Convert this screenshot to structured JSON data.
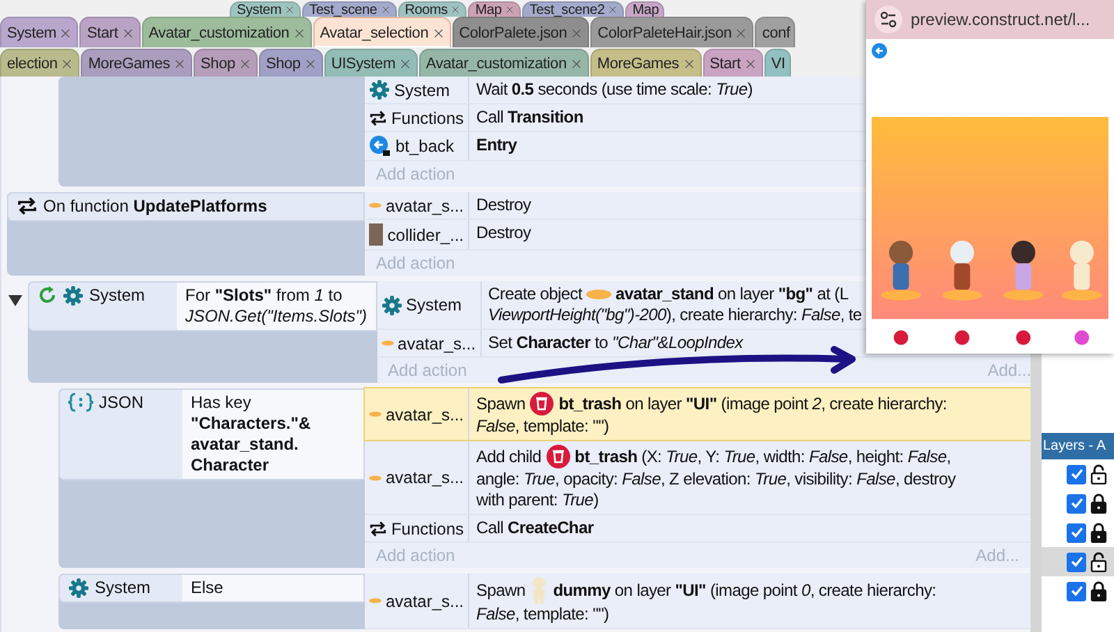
{
  "tab_rows": [
    {
      "tabs": [
        {
          "label": "System",
          "color": "#9ec3be",
          "selected": false
        },
        {
          "label": "Test_scene",
          "color": "#a3aacb",
          "selected": false
        },
        {
          "label": "Rooms",
          "color": "#9fc2c0",
          "selected": false
        },
        {
          "label": "Map",
          "color": "#cba2b3",
          "selected": false
        },
        {
          "label": "Test_scene2",
          "color": "#a3aacb",
          "selected": false
        },
        {
          "label": "Map",
          "color": "#c6a6c6",
          "selected": false
        }
      ]
    },
    {
      "tabs": [
        {
          "label": "System",
          "color": "#b8a6cc",
          "selected": false
        },
        {
          "label": "Start",
          "color": "#b9a2c3",
          "selected": false
        },
        {
          "label": "Avatar_customization",
          "color": "#9cbc9c",
          "selected": false
        },
        {
          "label": "Avatar_selection",
          "color": "#fde3d4",
          "selected": true
        },
        {
          "label": "ColorPalete.json",
          "color": "#8e8e8e",
          "selected": false
        },
        {
          "label": "ColorPaleteHair.json",
          "color": "#9a9a9a",
          "selected": false
        },
        {
          "label": "conf",
          "color": "#a0a0a0",
          "selected": false
        }
      ]
    },
    {
      "tabs": [
        {
          "label": "election",
          "color": "#babb8c",
          "selected": false
        },
        {
          "label": "MoreGames",
          "color": "#aa9dbd",
          "selected": false
        },
        {
          "label": "Shop",
          "color": "#b69dba",
          "selected": false
        },
        {
          "label": "Shop",
          "color": "#a0a0c6",
          "selected": false
        },
        {
          "label": "UISystem",
          "color": "#92bcb5",
          "selected": false
        },
        {
          "label": "Avatar_customization",
          "color": "#96b6a8",
          "selected": false
        },
        {
          "label": "MoreGames",
          "color": "#c5be89",
          "selected": false
        },
        {
          "label": "Start",
          "color": "#caa3c2",
          "selected": false
        },
        {
          "label": "VI",
          "color": "#92c0c0",
          "selected": false
        }
      ]
    }
  ],
  "events": [
    {
      "children": [
        {
          "actions": [
            {
              "object": "System",
              "kind": "gear",
              "selected": false,
              "lines": [
                [
                  {
                    "text": "Wait **0.5** seconds (use time scale: *True*)"
                  }
                ]
              ]
            },
            {
              "object": "Functions",
              "kind": "functions",
              "selected": false,
              "lines": [
                [
                  {
                    "text": "Call **Transition**"
                  }
                ]
              ]
            },
            {
              "object": "bt_back",
              "kind": "back",
              "selected": false,
              "lines": [
                [
                  {
                    "text": "**Entry**"
                  }
                ]
              ]
            }
          ],
          "add_action": "Add action"
        }
      ]
    },
    {
      "conditions": [
        {
          "kind": "functions",
          "lines": [
            "On function **UpdatePlatforms**"
          ]
        }
      ],
      "actions": [
        {
          "object": "avatar_s...",
          "kind": "platform",
          "selected": false,
          "lines": [
            [
              {
                "text": "Destroy"
              }
            ]
          ]
        },
        {
          "object": "collider_...",
          "kind": "collider",
          "selected": false,
          "lines": [
            [
              {
                "text": "Destroy"
              }
            ]
          ]
        }
      ],
      "add_action": "Add action"
    },
    {
      "expanded": true,
      "loop": true,
      "conditions": [
        {
          "object": "System",
          "kind": "gear",
          "lines": [
            "For **\"Slots\"** from *1* to",
            "*JSON.Get(\"Items.Slots\")*"
          ]
        }
      ],
      "actions": [
        {
          "object": "System",
          "kind": "gear",
          "selected": false,
          "lines": [
            [
              {
                "text": "Create object"
              },
              {
                "kind": "platform"
              },
              {
                "text": "**avatar_stand** on layer **\"bg\"** at (L"
              }
            ],
            [
              {
                "text": "*ViewportHeight(\"bg\")-200*), create hierarchy: *False*, te"
              }
            ]
          ]
        },
        {
          "object": "avatar_s...",
          "kind": "platform",
          "selected": false,
          "lines": [
            [
              {
                "text": "Set **Character** to *\"Char\"&LoopIndex*"
              }
            ]
          ]
        }
      ],
      "add_action": "Add action",
      "add_more": "Add...",
      "children": [
        {
          "conditions": [
            {
              "object": "JSON",
              "kind": "json",
              "lines": [
                "Has key",
                "**\"Characters.\"&**",
                "**avatar_stand.**",
                "**Character**"
              ]
            }
          ],
          "actions": [
            {
              "object": "avatar_s...",
              "kind": "platform",
              "selected": true,
              "lines": [
                [
                  {
                    "text": "Spawn"
                  },
                  {
                    "kind": "trash"
                  },
                  {
                    "text": "**bt_trash** on layer **\"UI\"** (image point *2*, create hierarchy:"
                  }
                ],
                [
                  {
                    "text": "*False*, template: \"\")"
                  }
                ]
              ]
            },
            {
              "object": "avatar_s...",
              "kind": "platform",
              "selected": false,
              "lines": [
                [
                  {
                    "text": "Add child"
                  },
                  {
                    "kind": "trash"
                  },
                  {
                    "text": "**bt_trash** (X: *True*, Y: *True*, width: *False*, height: *False*,"
                  }
                ],
                [
                  {
                    "text": "angle: *True*, opacity: *False*, Z elevation: *True*, visibility: *False*, destroy"
                  }
                ],
                [
                  {
                    "text": "with parent: *True*)"
                  }
                ]
              ]
            },
            {
              "object": "Functions",
              "kind": "functions",
              "selected": false,
              "lines": [
                [
                  {
                    "text": "Call **CreateChar**"
                  }
                ]
              ]
            }
          ],
          "add_action": "Add action",
          "add_more": "Add..."
        },
        {
          "conditions": [
            {
              "object": "System",
              "kind": "gear",
              "lines": [
                "Else"
              ]
            }
          ],
          "actions": [
            {
              "object": "avatar_s...",
              "kind": "platform",
              "selected": false,
              "lines": [
                [
                  {
                    "text": "Spawn"
                  },
                  {
                    "kind": "dummy"
                  },
                  {
                    "text": "**dummy** on layer **\"UI\"** (image point *0*, create hierarchy:"
                  }
                ],
                [
                  {
                    "text": "*False*, template: \"\")"
                  }
                ]
              ]
            }
          ]
        }
      ]
    }
  ],
  "preview": {
    "url": "preview.construct.net/l..."
  },
  "layers_panel": {
    "title": "Layers - A",
    "layers": [
      {
        "visible": true,
        "locked": false,
        "selected": false
      },
      {
        "visible": true,
        "locked": true,
        "selected": false
      },
      {
        "visible": true,
        "locked": true,
        "selected": false
      },
      {
        "visible": true,
        "locked": false,
        "selected": true
      },
      {
        "visible": true,
        "locked": true,
        "selected": false
      }
    ]
  }
}
